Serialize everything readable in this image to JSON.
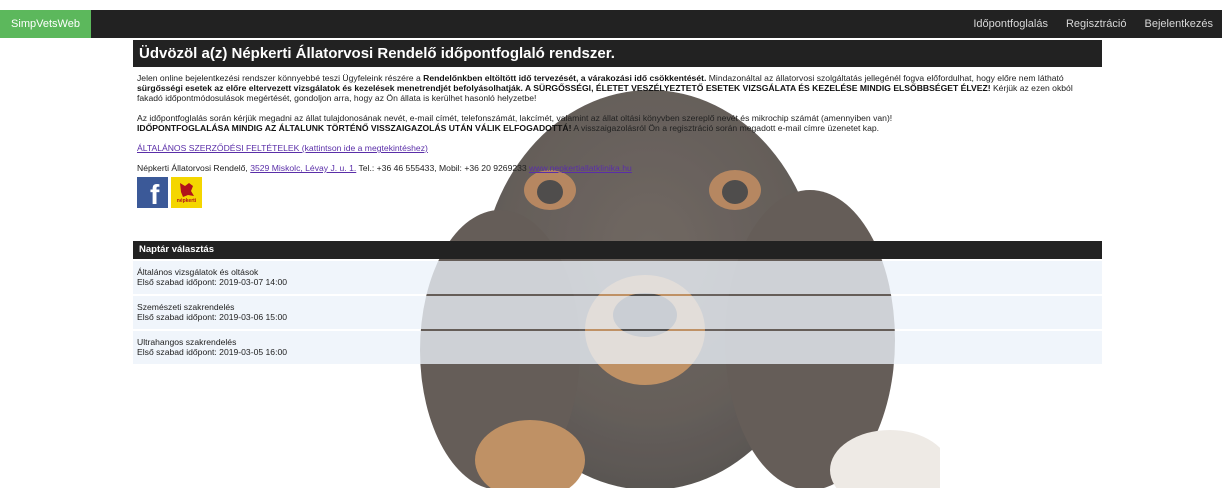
{
  "navbar": {
    "brand": "SimpVetsWeb",
    "links": [
      "Időpontfoglalás",
      "Regisztráció",
      "Bejelentkezés"
    ],
    "brand_color": "#5cb85c",
    "bar_color": "#222222"
  },
  "main": {
    "title": "Üdvözöl a(z) Népkerti Állatorvosi Rendelő időpontfoglaló rendszer.",
    "p1": {
      "t1": "Jelen online bejelentkezési rendszer könnyebbé teszi Ügyfeleink részére a ",
      "b1": "Rendelőnkben eltöltött idő tervezését, a várakozási idő csökkentését.",
      "t2": " Mindazonáltal az állatorvosi szolgáltatás jellegénél fogva előfordulhat, hogy előre nem látható ",
      "b2": "sürgősségi esetek az előre eltervezett vizsgálatok és kezelések menetrendjét befolyásolhatják. A SÜRGŐSSÉGI, ÉLETET VESZÉLYEZTETŐ ESETEK VIZSGÁLATA ÉS KEZELÉSE MINDIG ELSŐBBSÉGET ÉLVEZ!",
      "t3": " Kérjük az ezen okból fakadó időpontmódosulások megértését, gondoljon arra, hogy az Ön állata is kerülhet hasonló helyzetbe!"
    },
    "p2": {
      "t1": "Az időpontfoglalás során kérjük megadni az állat tulajdonosának nevét, e-mail címét, telefonszámát, lakcímét, valamint az állat oltási könyvben szereplő nevét és mikrochip számát (amennyiben van)!",
      "b1": "IDŐPONTFOGLALÁSA MINDIG AZ ÁLTALUNK TÖRTÉNŐ VISSZAIGAZOLÁS UTÁN VÁLIK ELFOGADOTTÁ!",
      "t2": " A visszaigazolásról Ön a regisztráció során megadott e-mail címre üzenetet kap."
    },
    "terms_link": "ÁLTALÁNOS SZERZŐDÉSI FELTÉTELEK (kattintson ide a megtekintéshez)",
    "contact": {
      "name": "Népkerti Állatorvosi Rendelő, ",
      "address": "3529 Miskolc, Lévay J. u. 1.",
      "phones": " Tel.: +36 46 555433, Mobil: +36 20 9269233 ",
      "website": "www.nepkertiallatklinika.hu"
    },
    "social": {
      "facebook_glyph": "f",
      "nepkerti_label": "népkerti"
    }
  },
  "calendar": {
    "header": "Naptár választás",
    "items": [
      {
        "name": "Általános vizsgálatok és oltások",
        "first_free": "Első szabad időpont: 2019-03-07 14:00"
      },
      {
        "name": "Szemészeti szakrendelés",
        "first_free": "Első szabad időpont: 2019-03-06 15:00"
      },
      {
        "name": "Ultrahangos szakrendelés",
        "first_free": "Első szabad időpont: 2019-03-05 16:00"
      }
    ]
  }
}
